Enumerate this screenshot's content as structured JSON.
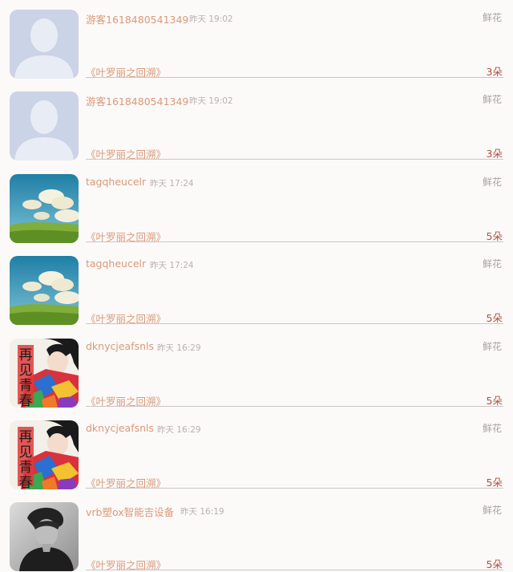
{
  "items": [
    {
      "username": "游客1618480541349",
      "time": "昨天 19:02",
      "gift_type": "鲜花",
      "book_title": "《叶罗丽之回溯》",
      "count": "3朵",
      "avatar_icon": "default-avatar-icon"
    },
    {
      "username": "游客1618480541349",
      "time": "昨天 19:02",
      "gift_type": "鲜花",
      "book_title": "《叶罗丽之回溯》",
      "count": "3朵",
      "avatar_icon": "default-avatar-icon"
    },
    {
      "username": "tagqheucelr",
      "time": "昨天 17:24",
      "gift_type": "鲜花",
      "book_title": "《叶罗丽之回溯》",
      "count": "5朵",
      "avatar_icon": "landscape-avatar-icon"
    },
    {
      "username": "tagqheucelr",
      "time": "昨天 17:24",
      "gift_type": "鲜花",
      "book_title": "《叶罗丽之回溯》",
      "count": "5朵",
      "avatar_icon": "landscape-avatar-icon"
    },
    {
      "username": "dknycjeafsnls",
      "time": "昨天 16:29",
      "gift_type": "鲜花",
      "book_title": "《叶罗丽之回溯》",
      "count": "5朵",
      "avatar_icon": "poster-avatar-icon",
      "avatar_text": "再见青春"
    },
    {
      "username": "dknycjeafsnls",
      "time": "昨天 16:29",
      "gift_type": "鲜花",
      "book_title": "《叶罗丽之回溯》",
      "count": "5朵",
      "avatar_icon": "poster-avatar-icon",
      "avatar_text": "再见青春"
    },
    {
      "username": "vrb塑ox智能吉设备",
      "time": "昨天 16:19",
      "gift_type": "鲜花",
      "book_title": "《叶罗丽之回溯》",
      "count": "5朵",
      "avatar_icon": "portrait-avatar-icon"
    }
  ],
  "colors": {
    "background": "#fcf9f9",
    "username": "#d89a78",
    "book_title": "#d89a78",
    "count": "#b0503e",
    "time": "#b9b2b2",
    "gift_type": "#a9a2a2"
  }
}
